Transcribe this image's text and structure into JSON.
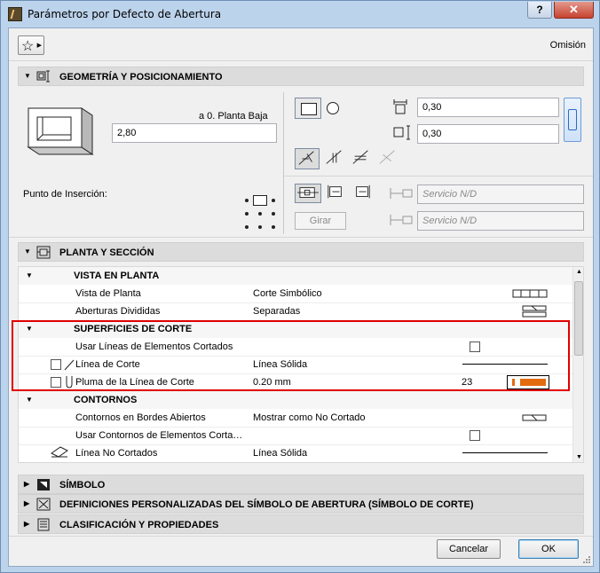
{
  "window": {
    "title": "Parámetros por Defecto de Abertura",
    "help_label": "?",
    "close_label": "✕"
  },
  "header": {
    "favorites_icon": "star-icon",
    "omision": "Omisión"
  },
  "sections": {
    "geometria": "GEOMETRÍA Y POSICIONAMIENTO",
    "planta_seccion": "PLANTA Y SECCIÓN",
    "simbolo": "SÍMBOLO",
    "definiciones": "DEFINICIONES PERSONALIZADAS DEL SÍMBOLO DE ABERTURA (SÍMBOLO DE CORTE)",
    "clasificacion": "CLASIFICACIÓN Y PROPIEDADES"
  },
  "geometry": {
    "story_label": "a 0. Planta Baja",
    "height_value": "2,80",
    "width_value": "0,30",
    "depth_value": "0,30",
    "insertion_label": "Punto de Inserción:",
    "rotate_label": "Girar",
    "service_1": "Servicio N/D",
    "service_2": "Servicio N/D"
  },
  "list": {
    "rows": [
      {
        "type": "group",
        "label": "VISTA EN PLANTA"
      },
      {
        "type": "item",
        "label": "Vista de Planta",
        "value": "Corte Simbólico"
      },
      {
        "type": "item",
        "label": "Aberturas Divididas",
        "value": "Separadas"
      },
      {
        "type": "group",
        "label": "SUPERFICIES DE CORTE"
      },
      {
        "type": "item",
        "label": "Usar Líneas de Elementos Cortados",
        "value": ""
      },
      {
        "type": "item",
        "label": "Línea de Corte",
        "value": "Línea Sólida"
      },
      {
        "type": "item",
        "label": "Pluma de la Línea de Corte",
        "value": "0.20 mm",
        "number": "23"
      },
      {
        "type": "group",
        "label": "CONTORNOS"
      },
      {
        "type": "item",
        "label": "Contornos en Bordes Abiertos",
        "value": "Mostrar como No Cortado"
      },
      {
        "type": "item",
        "label": "Usar Contornos de Elementos Corta…",
        "value": ""
      },
      {
        "type": "item",
        "label": "Línea No Cortados",
        "value": "Línea Sólida"
      }
    ]
  },
  "footer": {
    "cancel": "Cancelar",
    "ok": "OK"
  },
  "colors": {
    "pen_color": "#e36b10",
    "highlight": "#e00000"
  }
}
